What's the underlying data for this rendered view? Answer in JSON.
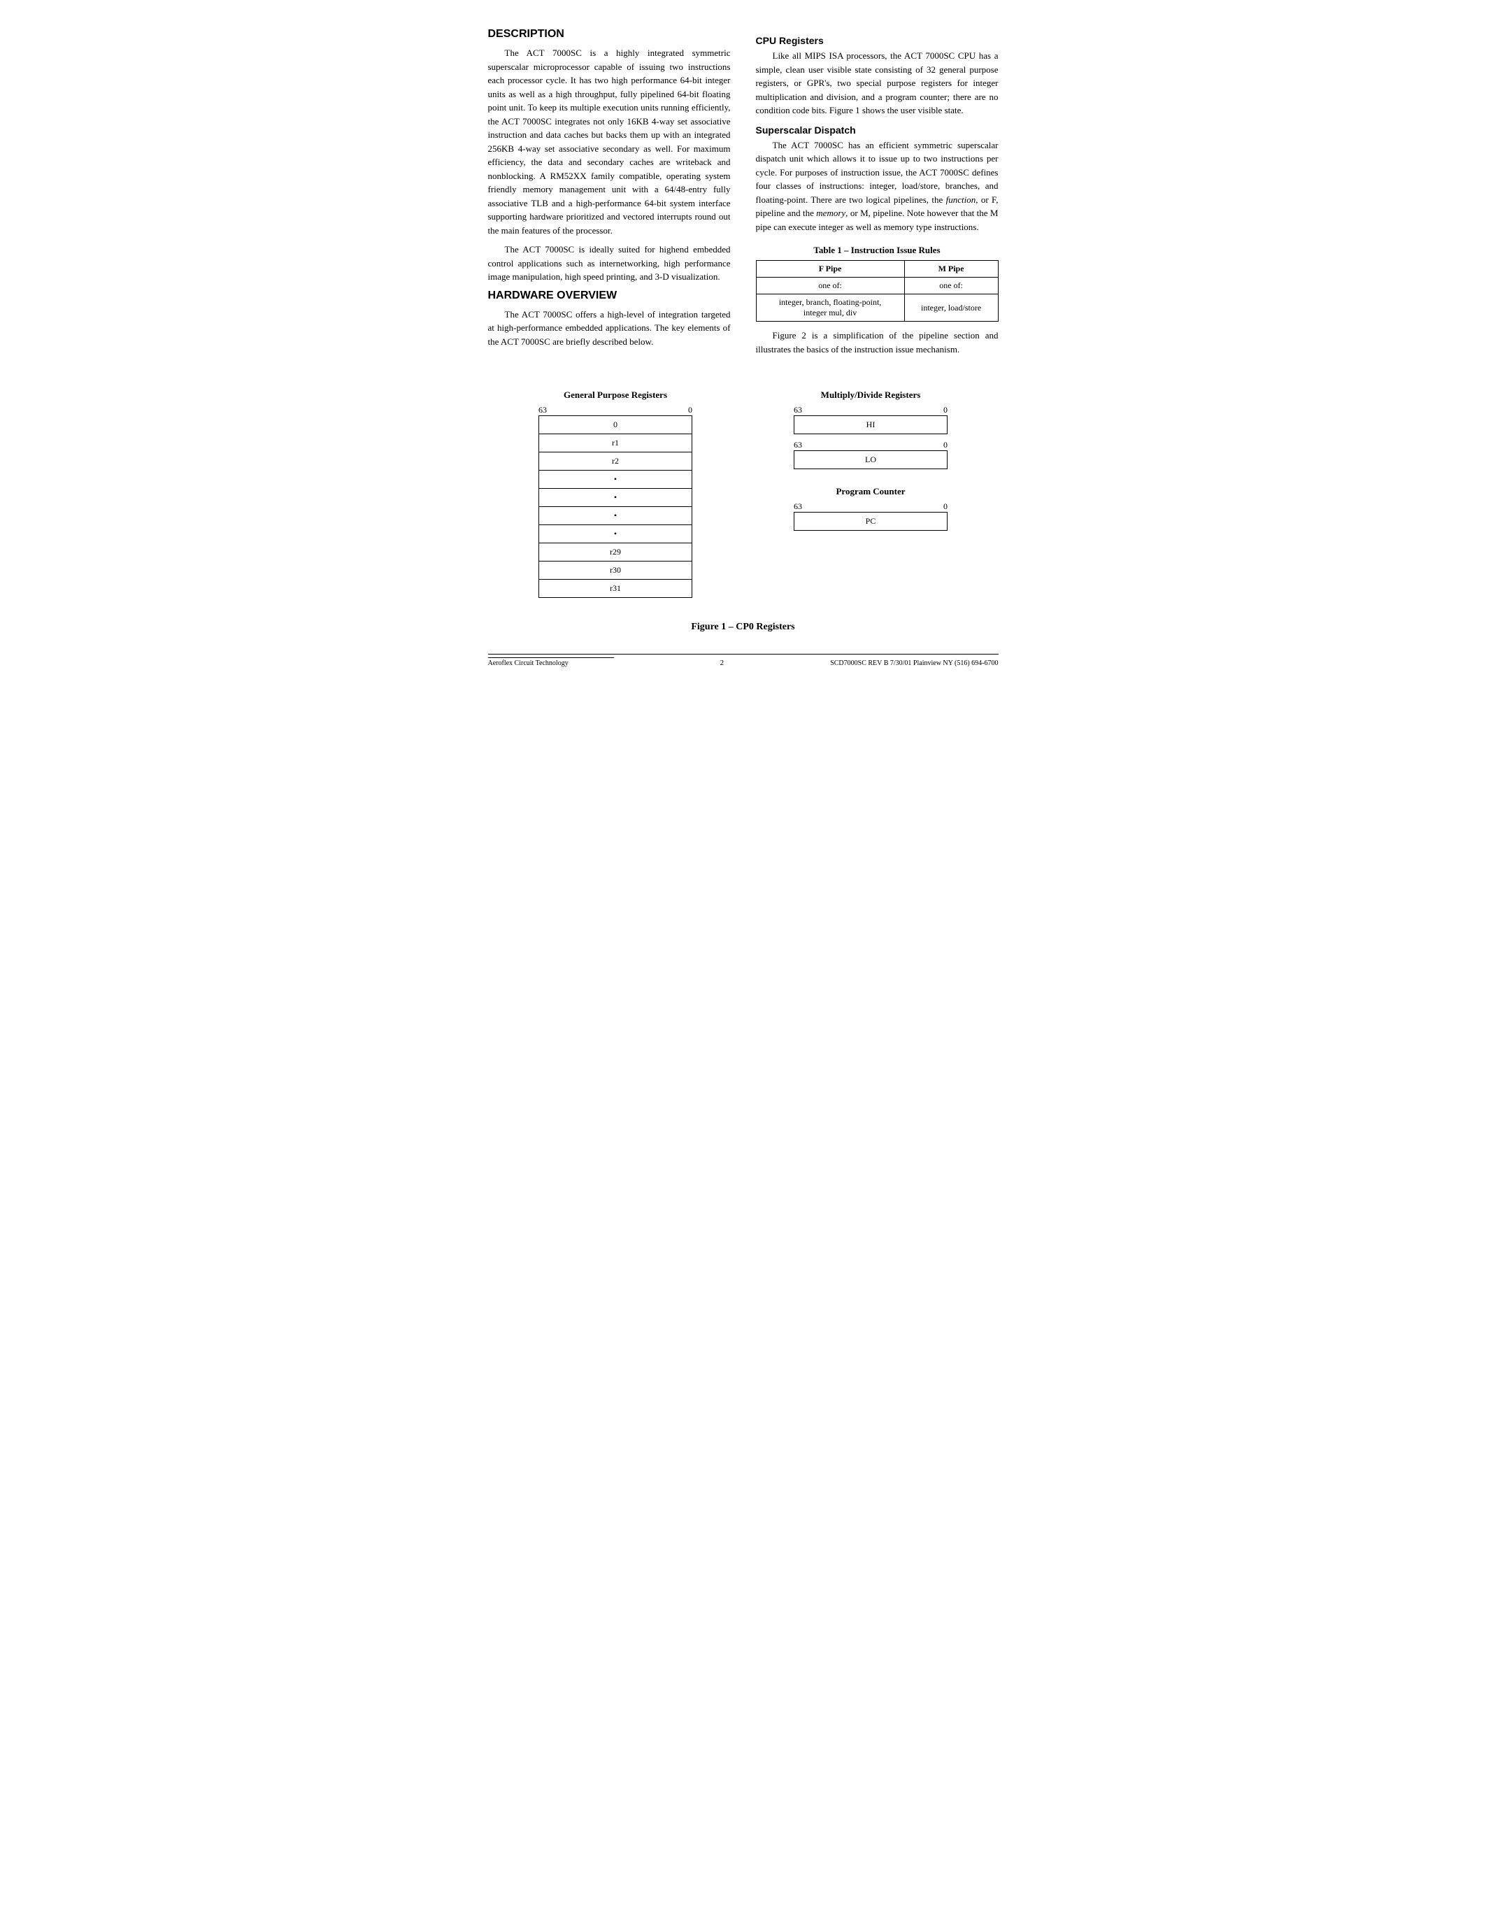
{
  "page": {
    "sections": {
      "description": {
        "title": "Description",
        "paragraphs": [
          "The ACT 7000SC is a highly integrated symmetric superscalar microprocessor capable of issuing two instructions each processor cycle. It has two high performance 64-bit integer units as well as a high throughput, fully pipelined 64-bit floating point unit. To keep its multiple execution units running efficiently, the ACT 7000SC integrates not only 16KB 4-way set associative instruction and data caches but backs them up with an integrated 256KB 4-way set associative secondary as well. For maximum efficiency, the data and secondary caches are writeback and nonblocking. A RM52XX family compatible, operating system friendly memory management unit with a 64/48-entry fully associative TLB and a high-performance 64-bit system interface supporting hardware prioritized and vectored interrupts round out the main features of the processor.",
          "The ACT 7000SC is ideally suited for highend embedded control applications such as internetworking, high performance image manipulation, high speed printing, and 3-D visualization."
        ]
      },
      "hardware_overview": {
        "title": "Hardware Overview",
        "paragraphs": [
          "The ACT 7000SC offers a high-level of integration targeted at high-performance embedded applications. The key elements of the ACT 7000SC are briefly described below."
        ]
      },
      "cpu_registers": {
        "title": "CPU Registers",
        "paragraphs": [
          "Like all MIPS ISA processors, the ACT 7000SC CPU has a simple, clean user visible state consisting of 32 general purpose registers, or GPR's, two special purpose registers for integer multiplication and division, and a program counter; there are no condition code bits. Figure 1 shows the user visible state."
        ]
      },
      "superscalar_dispatch": {
        "title": "Superscalar Dispatch",
        "paragraphs": [
          "The ACT 7000SC has an efficient symmetric superscalar dispatch unit which allows it to issue up to two instructions per cycle. For purposes of instruction issue, the ACT 7000SC defines four classes of instructions: integer, load/store, branches, and floating-point. There are two logical pipelines, the function, or F, pipeline and the memory, or M, pipeline. Note however that the M pipe can execute integer as well as memory type instructions."
        ]
      },
      "table": {
        "title": "Table 1 – Instruction Issue Rules",
        "headers": [
          "F Pipe",
          "M Pipe"
        ],
        "rows": [
          [
            "one of:",
            "one of:"
          ],
          [
            "integer, branch, floating-point,\ninteger mul, div",
            "integer, load/store"
          ]
        ]
      },
      "figure_note": "Figure 2 is a simplification of the pipeline section and illustrates the basics of the instruction issue mechanism."
    },
    "figure": {
      "caption": "Figure 1 – CP0 Registers",
      "gpr": {
        "title": "General Purpose Registers",
        "bit_high": "63",
        "bit_low": "0",
        "rows": [
          "0",
          "r1",
          "r2",
          "•",
          "•",
          "•",
          "•",
          "r29",
          "r30",
          "r31"
        ]
      },
      "multiply": {
        "title": "Multiply/Divide Registers",
        "bit_high": "63",
        "bit_low": "0",
        "registers": [
          {
            "label": "HI",
            "bit_high": "63",
            "bit_low": "0"
          },
          {
            "label": "LO",
            "bit_high": "63",
            "bit_low": "0"
          }
        ]
      },
      "program_counter": {
        "title": "Program Counter",
        "bit_high": "63",
        "bit_low": "0",
        "label": "PC"
      }
    },
    "footer": {
      "left": "Aeroflex Circuit Technology",
      "center": "2",
      "right": "SCD7000SC REV B  7/30/01  Plainview NY (516) 694-6700"
    }
  }
}
